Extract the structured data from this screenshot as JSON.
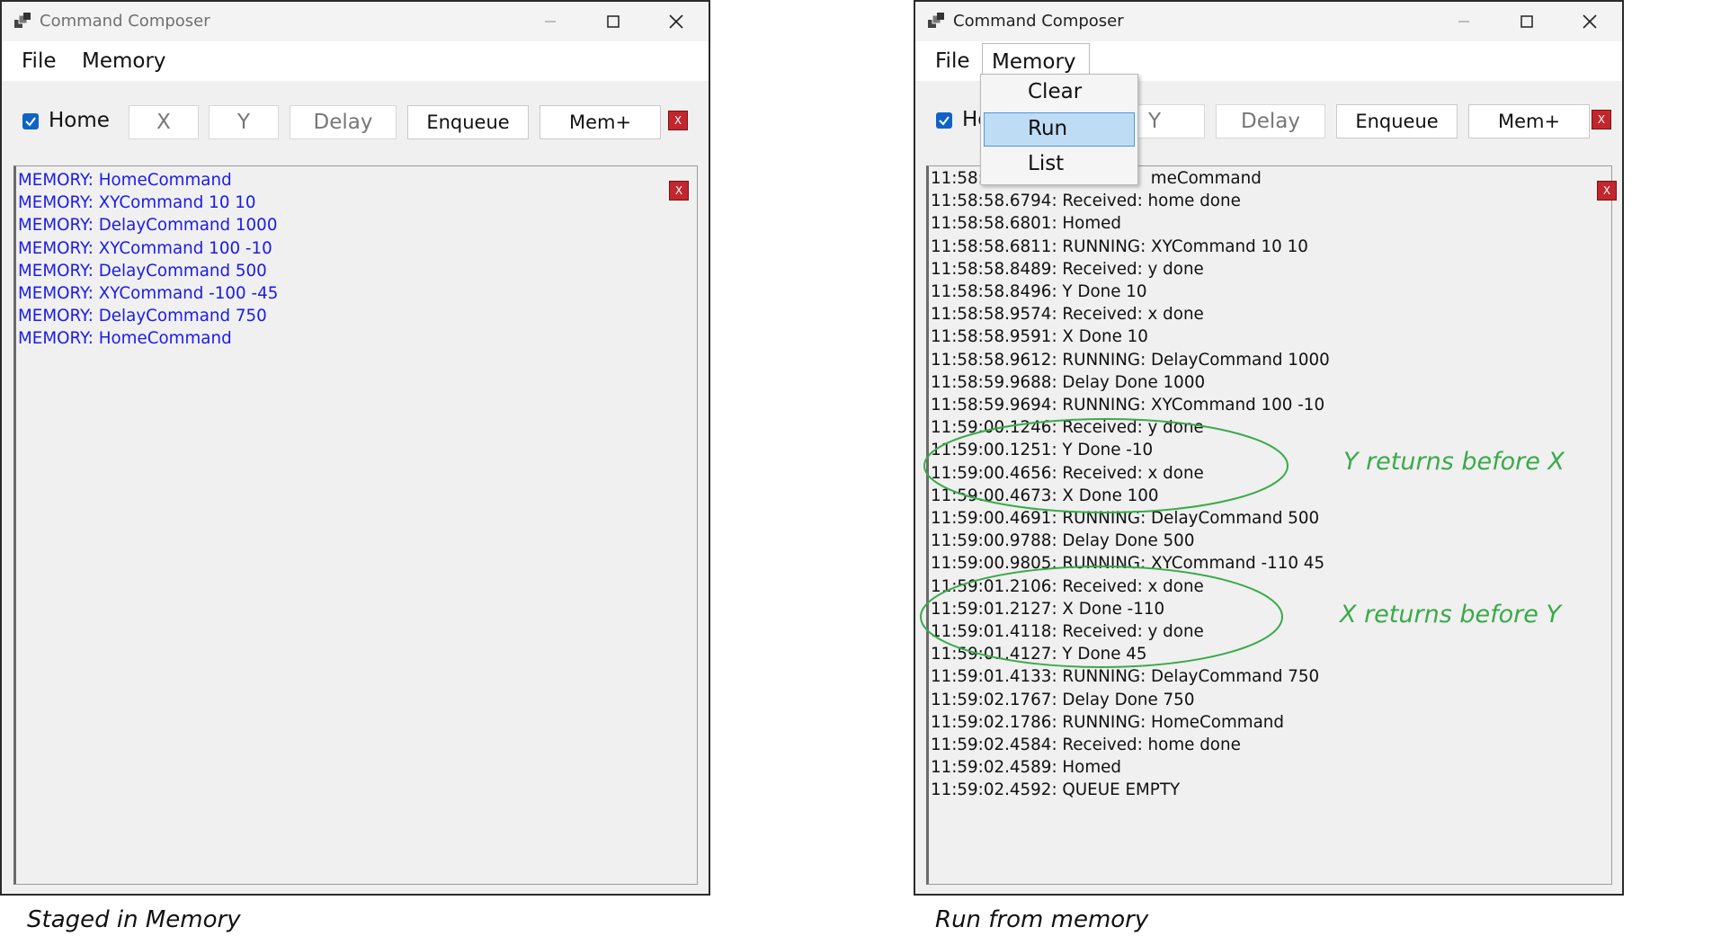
{
  "windows": [
    {
      "title": "Command Composer",
      "menu": [
        "File",
        "Memory"
      ],
      "toolbar": {
        "home_checked": true,
        "home_label": "Home",
        "x_placeholder": "X",
        "y_placeholder": "Y",
        "delay_placeholder": "Delay",
        "enqueue_label": "Enqueue",
        "memplus_label": "Mem+",
        "clear_label": "X"
      },
      "log_clear_label": "X",
      "log": [
        "MEMORY: HomeCommand",
        "MEMORY: XYCommand 10 10",
        "MEMORY: DelayCommand 1000",
        "MEMORY: XYCommand 100 -10",
        "MEMORY: DelayCommand 500",
        "MEMORY: XYCommand -100 -45",
        "MEMORY: DelayCommand 750",
        "MEMORY: HomeCommand"
      ]
    },
    {
      "title": "Command Composer",
      "menu": [
        "File",
        "Memory"
      ],
      "menu_open": "Memory",
      "dropdown": [
        "Clear",
        "Run",
        "List"
      ],
      "dropdown_highlighted": "Run",
      "toolbar": {
        "home_checked": true,
        "home_label": "Ho",
        "y_placeholder": "Y",
        "delay_placeholder": "Delay",
        "enqueue_label": "Enqueue",
        "memplus_label": "Mem+",
        "clear_label": "X"
      },
      "log_clear_label": "X",
      "log": [
        "11:58:5                              meCommand",
        "11:58:58.6794: Received: home done",
        "11:58:58.6801: Homed",
        "11:58:58.6811: RUNNING: XYCommand 10 10",
        "11:58:58.8489: Received: y done",
        "11:58:58.8496: Y Done 10",
        "11:58:58.9574: Received: x done",
        "11:58:58.9591: X Done 10",
        "11:58:58.9612: RUNNING: DelayCommand 1000",
        "11:58:59.9688: Delay Done 1000",
        "11:58:59.9694: RUNNING: XYCommand 100 -10",
        "11:59:00.1246: Received: y done",
        "11:59:00.1251: Y Done -10",
        "11:59:00.4656: Received: x done",
        "11:59:00.4673: X Done 100",
        "11:59:00.4691: RUNNING: DelayCommand 500",
        "11:59:00.9788: Delay Done 500",
        "11:59:00.9805: RUNNING: XYCommand -110 45",
        "11:59:01.2106: Received: x done",
        "11:59:01.2127: X Done -110",
        "11:59:01.4118: Received: y done",
        "11:59:01.4127: Y Done 45",
        "11:59:01.4133: RUNNING: DelayCommand 750",
        "11:59:02.1767: Delay Done 750",
        "11:59:02.1786: RUNNING: HomeCommand",
        "11:59:02.4584: Received: home done",
        "11:59:02.4589: Homed",
        "11:59:02.4592: QUEUE EMPTY"
      ]
    }
  ],
  "annotations": {
    "y_before_x": "Y returns before X",
    "x_before_y": "X returns before Y",
    "color": "#3aaa4a"
  },
  "captions": {
    "left": "Staged in Memory",
    "right": "Run from memory"
  }
}
